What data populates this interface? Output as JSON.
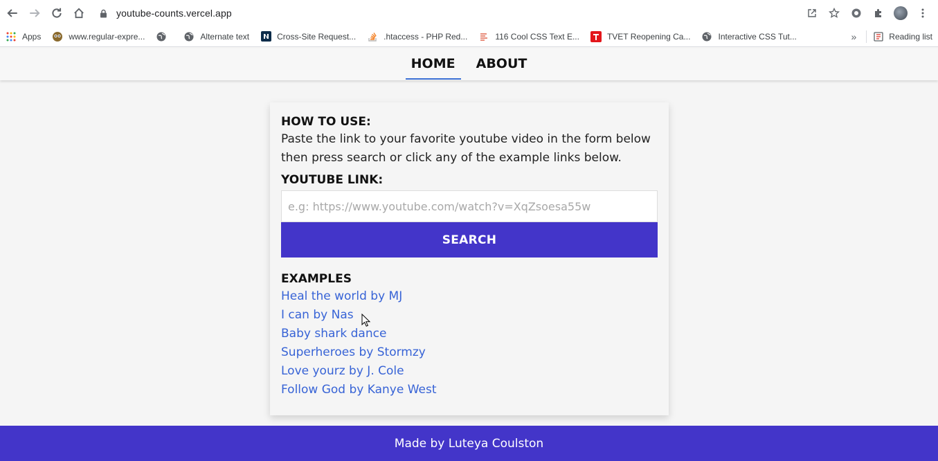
{
  "browser": {
    "url": "youtube-counts.vercel.app",
    "bookmarks": [
      {
        "label": "Apps",
        "icon": "apps-grid-icon"
      },
      {
        "label": "www.regular-expre...",
        "icon": "owl-icon"
      },
      {
        "label": "",
        "icon": "globe-icon"
      },
      {
        "label": "Alternate text",
        "icon": "globe-icon"
      },
      {
        "label": "Cross-Site Request...",
        "icon": "n-logo-icon"
      },
      {
        "label": ".htaccess - PHP Red...",
        "icon": "stack-icon"
      },
      {
        "label": "116 Cool CSS Text E...",
        "icon": "list-icon"
      },
      {
        "label": "TVET Reopening Ca...",
        "icon": "t-logo-icon"
      },
      {
        "label": "Interactive CSS Tut...",
        "icon": "globe-icon"
      }
    ],
    "more_bookmarks": "»",
    "reading_list": "Reading list"
  },
  "nav": {
    "home": "HOME",
    "about": "ABOUT"
  },
  "card": {
    "how_title": "HOW TO USE:",
    "instructions": "Paste the link to your favorite youtube video in the form below then press search or click any of the example links below.",
    "link_label": "YOUTUBE LINK:",
    "input_placeholder": "e.g: https://www.youtube.com/watch?v=XqZsoesa55w",
    "input_value": "",
    "search_label": "SEARCH",
    "examples_title": "EXAMPLES",
    "examples": [
      "Heal the world by MJ",
      "I can by Nas",
      "Baby shark dance",
      "Superheroes by Stormzy",
      "Love yourz by J. Cole",
      "Follow God by Kanye West"
    ]
  },
  "footer": {
    "text": "Made by Luteya Coulston"
  },
  "colors": {
    "accent": "#4335c9",
    "link": "#3763d6",
    "nav_underline": "#3b6fd4"
  }
}
